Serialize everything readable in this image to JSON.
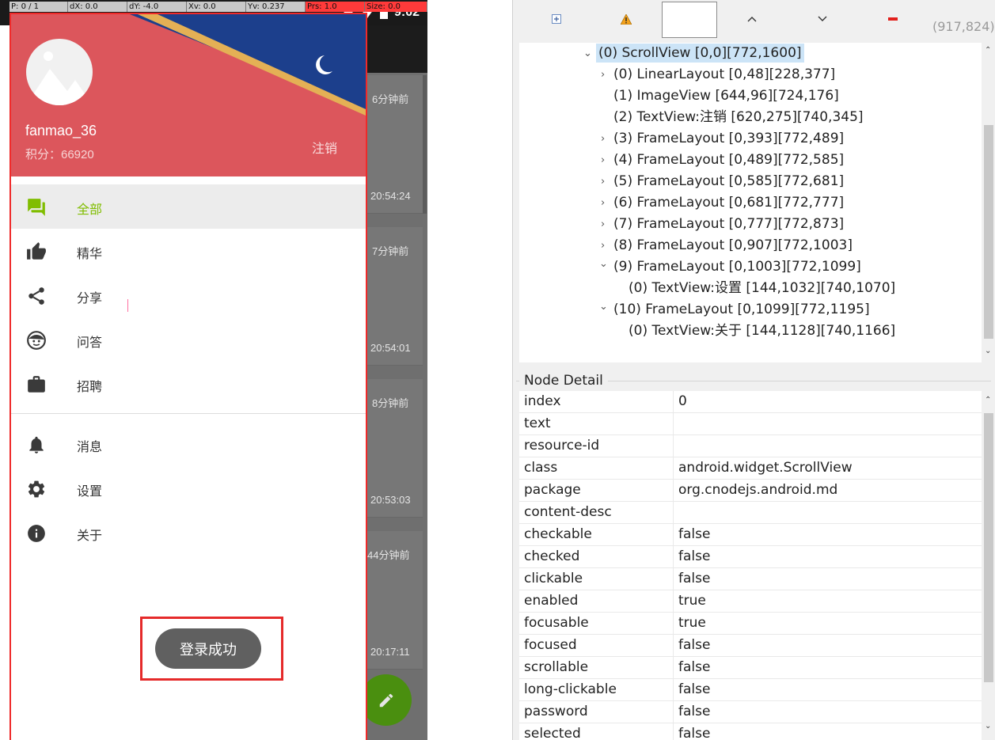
{
  "pointer_bar": {
    "p": "P: 0 / 1",
    "dx": "dX: 0.0",
    "dy": "dY: -4.0",
    "xv": "Xv: 0.0",
    "yv": "Yv: 0.237",
    "prs": "Prs: 1.0",
    "size": "Size: 0.0"
  },
  "status_bar": {
    "time": "9:02"
  },
  "background_list": {
    "items": [
      {
        "relative": "6分钟前",
        "time": "20:54:24"
      },
      {
        "relative": "7分钟前",
        "time": "20:54:01"
      },
      {
        "relative": "8分钟前",
        "time": "20:53:03"
      },
      {
        "relative": "44分钟前",
        "time": "20:17:11"
      }
    ]
  },
  "drawer": {
    "username": "fanmao_36",
    "score": "积分：66920",
    "logout": "注销",
    "menu": [
      {
        "label": "全部",
        "icon": "forum-icon",
        "active": true
      },
      {
        "label": "精华",
        "icon": "thumb-up-icon",
        "active": false
      },
      {
        "label": "分享",
        "icon": "share-icon",
        "active": false
      },
      {
        "label": "问答",
        "icon": "face-icon",
        "active": false
      },
      {
        "label": "招聘",
        "icon": "briefcase-icon",
        "active": false
      }
    ],
    "menu2": [
      {
        "label": "消息",
        "icon": "bell-icon"
      },
      {
        "label": "设置",
        "icon": "gear-icon"
      },
      {
        "label": "关于",
        "icon": "info-icon"
      }
    ],
    "colors": {
      "header": "#dc565c",
      "accent": "#80bd00"
    }
  },
  "toast": {
    "text": "登录成功"
  },
  "inspector": {
    "coords": "(917,824)",
    "tree": [
      {
        "text": "(0) ScrollView [0,0][772,1600]",
        "chev": "expanded",
        "selected": true
      },
      {
        "text": "(0) LinearLayout [0,48][228,377]",
        "chev": "collapsed"
      },
      {
        "text": "(1) ImageView [644,96][724,176]",
        "chev": "none"
      },
      {
        "text": "(2) TextView:注销 [620,275][740,345]",
        "chev": "none"
      },
      {
        "text": "(3) FrameLayout [0,393][772,489]",
        "chev": "collapsed"
      },
      {
        "text": "(4) FrameLayout [0,489][772,585]",
        "chev": "collapsed"
      },
      {
        "text": "(5) FrameLayout [0,585][772,681]",
        "chev": "collapsed"
      },
      {
        "text": "(6) FrameLayout [0,681][772,777]",
        "chev": "collapsed"
      },
      {
        "text": "(7) FrameLayout [0,777][772,873]",
        "chev": "collapsed"
      },
      {
        "text": "(8) FrameLayout [0,907][772,1003]",
        "chev": "collapsed"
      },
      {
        "text": "(9) FrameLayout [0,1003][772,1099]",
        "chev": "expanded"
      },
      {
        "text": "(0) TextView:设置 [144,1032][740,1070]",
        "chev": "none"
      },
      {
        "text": "(10) FrameLayout [0,1099][772,1195]",
        "chev": "expanded"
      },
      {
        "text": "(0) TextView:关于 [144,1128][740,1166]",
        "chev": "none"
      }
    ],
    "node_detail_title": "Node Detail",
    "node_detail": [
      {
        "key": "index",
        "value": "0"
      },
      {
        "key": "text",
        "value": ""
      },
      {
        "key": "resource-id",
        "value": ""
      },
      {
        "key": "class",
        "value": "android.widget.ScrollView"
      },
      {
        "key": "package",
        "value": "org.cnodejs.android.md"
      },
      {
        "key": "content-desc",
        "value": ""
      },
      {
        "key": "checkable",
        "value": "false"
      },
      {
        "key": "checked",
        "value": "false"
      },
      {
        "key": "clickable",
        "value": "false"
      },
      {
        "key": "enabled",
        "value": "true"
      },
      {
        "key": "focusable",
        "value": "true"
      },
      {
        "key": "focused",
        "value": "false"
      },
      {
        "key": "scrollable",
        "value": "false"
      },
      {
        "key": "long-clickable",
        "value": "false"
      },
      {
        "key": "password",
        "value": "false"
      },
      {
        "key": "selected",
        "value": "false"
      }
    ]
  }
}
